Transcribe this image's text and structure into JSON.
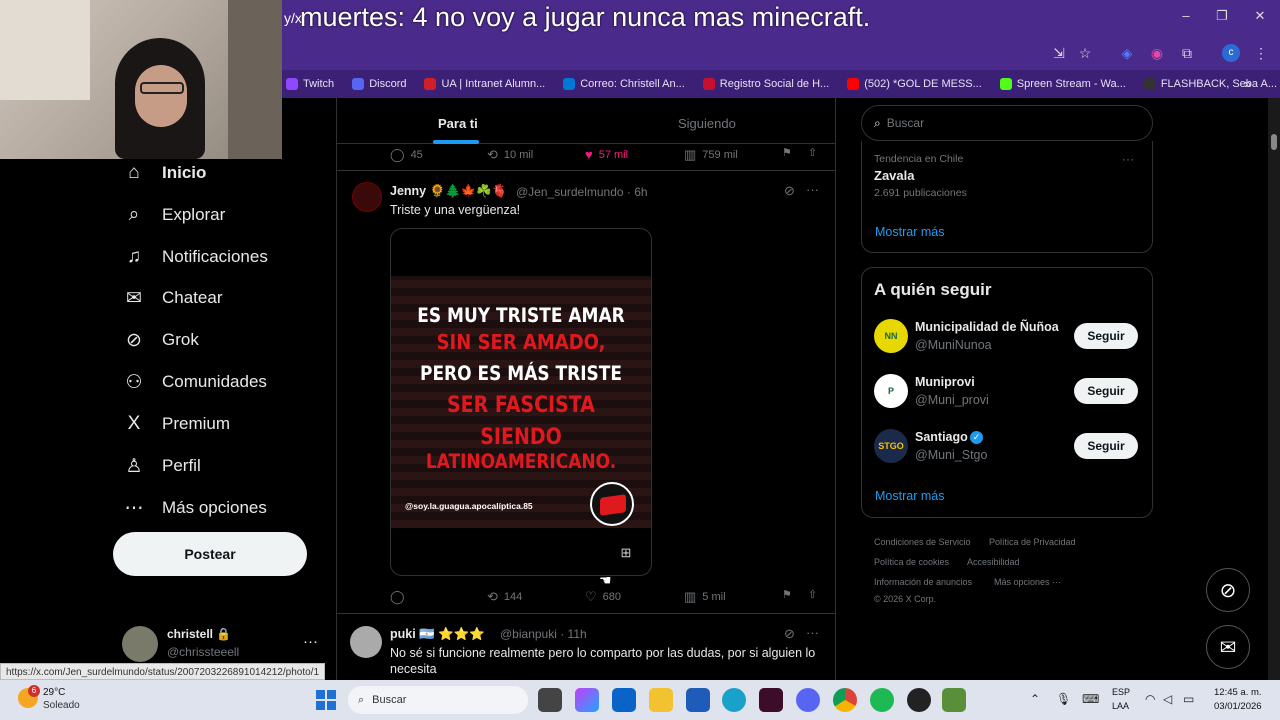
{
  "overlay": {
    "prefix": "y/x",
    "text": "muertes: 4 no voy a jugar nunca mas minecraft."
  },
  "window_controls": {
    "minimize": "–",
    "maximize": "❐",
    "close": "✕"
  },
  "bookmarks": [
    {
      "label": "Twitch",
      "color": "#9146ff"
    },
    {
      "label": "Discord",
      "color": "#5865f2"
    },
    {
      "label": "UA | Intranet Alumn...",
      "color": "#d01f26"
    },
    {
      "label": "Correo: Christell An...",
      "color": "#0078d4"
    },
    {
      "label": "Registro Social de H...",
      "color": "#c8102e"
    },
    {
      "label": "(502) *GOL DE MESS...",
      "color": "#ff0000"
    },
    {
      "label": "Spreen Stream - Wa...",
      "color": "#53fc18"
    },
    {
      "label": "FLASHBACK, Seba A...",
      "color": "#333333"
    }
  ],
  "bookmarks_more": "»",
  "nav": {
    "items": [
      {
        "label": "Inicio",
        "icon": "⌂"
      },
      {
        "label": "Explorar",
        "icon": "⌕"
      },
      {
        "label": "Notificaciones",
        "icon": "♫"
      },
      {
        "label": "Chatear",
        "icon": "✉"
      },
      {
        "label": "Grok",
        "icon": "⊘"
      },
      {
        "label": "Comunidades",
        "icon": "⚇"
      },
      {
        "label": "Premium",
        "icon": "X"
      },
      {
        "label": "Perfil",
        "icon": "♙"
      },
      {
        "label": "Más opciones",
        "icon": "⋯"
      }
    ],
    "post_label": "Postear"
  },
  "account": {
    "name": "christell 🔒",
    "handle": "@chrissteeell",
    "more": "···"
  },
  "status_url": "https://x.com/Jen_surdelmundo/status/2007203226891014212/photo/1",
  "tabs": {
    "for_you": "Para ti",
    "following": "Siguiendo"
  },
  "prev_tweet_actions": {
    "replies": "45",
    "reposts": "10 mil",
    "likes": "57 mil",
    "views": "759 mil"
  },
  "tweet": {
    "name": "Jenny 🌻🌲🍁☘️🫀",
    "handle": "@Jen_surdelmundo · 6h",
    "text": "Triste y una vergüenza!",
    "poster_lines": [
      {
        "text": "ES MUY TRISTE AMAR",
        "color": "#ffffff"
      },
      {
        "text": "SIN SER AMADO,",
        "color": "#e0191e"
      },
      {
        "text": "PERO ES MÁS TRISTE",
        "color": "#ffffff"
      },
      {
        "text": "SER FASCISTA",
        "color": "#e0191e"
      },
      {
        "text": "SIENDO",
        "color": "#e0191e"
      },
      {
        "text": "LATINOAMERICANO.",
        "color": "#e0191e"
      }
    ],
    "poster_credit": "@soy.la.guagua.apocalíptica.85",
    "actions": {
      "reposts": "144",
      "likes": "680",
      "views": "5 mil"
    }
  },
  "next_tweet": {
    "name": "puki 🇦🇷 ⭐⭐⭐",
    "handle": "@bianpuki · 11h",
    "text": "No sé si funcione realmente pero lo comparto por las dudas, por si alguien lo necesita"
  },
  "search": {
    "placeholder": "Buscar"
  },
  "trend": {
    "context": "Tendencia en Chile",
    "title": "Zavala",
    "count": "2.691 publicaciones",
    "more": "Mostrar más"
  },
  "who_to_follow": {
    "title": "A quién seguir",
    "accounts": [
      {
        "name": "Municipalidad de Ñuñoa",
        "handle": "@MuniNunoa",
        "button": "Seguir",
        "color": "#e6d800",
        "initials": "NN"
      },
      {
        "name": "Muniprovi",
        "handle": "@Muni_provi",
        "button": "Seguir",
        "color": "#ffffff",
        "initials": "P"
      },
      {
        "name": "Santiago",
        "handle": "@Muni_Stgo",
        "button": "Seguir",
        "color": "#1b2a4a",
        "initials": "STGO"
      }
    ],
    "more": "Mostrar más"
  },
  "footer": {
    "links": [
      "Condiciones de Servicio",
      "Política de Privacidad",
      "Política de cookies",
      "Accesibilidad",
      "Información de anuncios",
      "Más opciones ···"
    ],
    "copyright": "© 2026 X Corp."
  },
  "taskbar": {
    "weather_temp": "29°C",
    "weather_desc": "Soleado",
    "weather_badge": "6",
    "search": "Buscar",
    "lang_top": "ESP",
    "lang_bottom": "LAA",
    "time": "12:45 a. m.",
    "date": "03/01/2026"
  }
}
